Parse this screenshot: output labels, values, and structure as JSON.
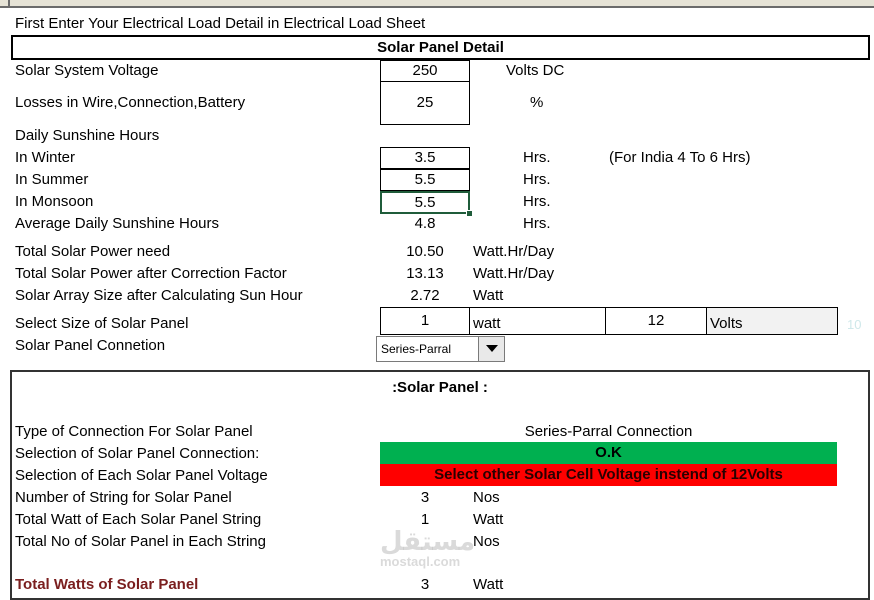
{
  "header_note": "First Enter Your Electrical Load Detail in Electrical Load Sheet",
  "section_title": "Solar Panel Detail",
  "rows": {
    "system_voltage": {
      "label": "Solar System Voltage",
      "value": "250",
      "unit": "Volts DC"
    },
    "losses": {
      "label": "Losses in Wire,Connection,Battery",
      "value": "25",
      "unit": "%"
    },
    "sunshine_heading": "Daily Sunshine Hours",
    "winter": {
      "label": "In Winter",
      "value": "3.5",
      "unit": "Hrs.",
      "note": "(For India 4 To 6 Hrs)"
    },
    "summer": {
      "label": "In Summer",
      "value": "5.5",
      "unit": "Hrs."
    },
    "monsoon": {
      "label": "In Monsoon",
      "value": "5.5",
      "unit": "Hrs."
    },
    "average": {
      "label": "Average Daily Sunshine Hours",
      "value": "4.8",
      "unit": "Hrs."
    },
    "total_power": {
      "label": "Total Solar Power need",
      "value": "10.50",
      "unit": "Watt.Hr/Day"
    },
    "total_power_corr": {
      "label": "Total Solar Power after Correction Factor",
      "value": "13.13",
      "unit": "Watt.Hr/Day"
    },
    "array_size": {
      "label": "Solar Array Size after Calculating Sun Hour",
      "value": "2.72",
      "unit": "Watt"
    },
    "panel_size": {
      "label": "Select Size of Solar Panel",
      "watt_value": "1",
      "watt_unit": "watt",
      "volt_value": "12",
      "volt_unit": "Volts",
      "faint_value": "10"
    },
    "connection": {
      "label": "Solar Panel Connetion",
      "selected": "Series-Parral"
    }
  },
  "panel": {
    "title": ":Solar Panel :",
    "type_label": "Type of Connection For Solar Panel",
    "type_value": "Series-Parral Connection",
    "selection_label": "Selection of Solar Panel Connection:",
    "selection_value": "O.K",
    "voltage_label": "Selection of Each Solar Panel Voltage",
    "voltage_value": "Select other Solar Cell Voltage instend of 12Volts",
    "strings_label": "Number of String for Solar Panel",
    "strings_value": "3",
    "strings_unit": "Nos",
    "watt_string_label": "Total Watt of Each Solar Panel String",
    "watt_string_value": "1",
    "watt_string_unit": "Watt",
    "panels_string_label": "Total No of Solar Panel in Each String",
    "panels_string_unit": "Nos",
    "total_watts_label": "Total Watts of Solar Panel",
    "total_watts_value": "3",
    "total_watts_unit": "Watt"
  },
  "watermark": {
    "arabic": "مستقل",
    "latin": "mostaql.com"
  },
  "colors": {
    "ok_band": "#00b050",
    "warn_band": "#ff0000",
    "total_label": "#7a1e1e"
  }
}
